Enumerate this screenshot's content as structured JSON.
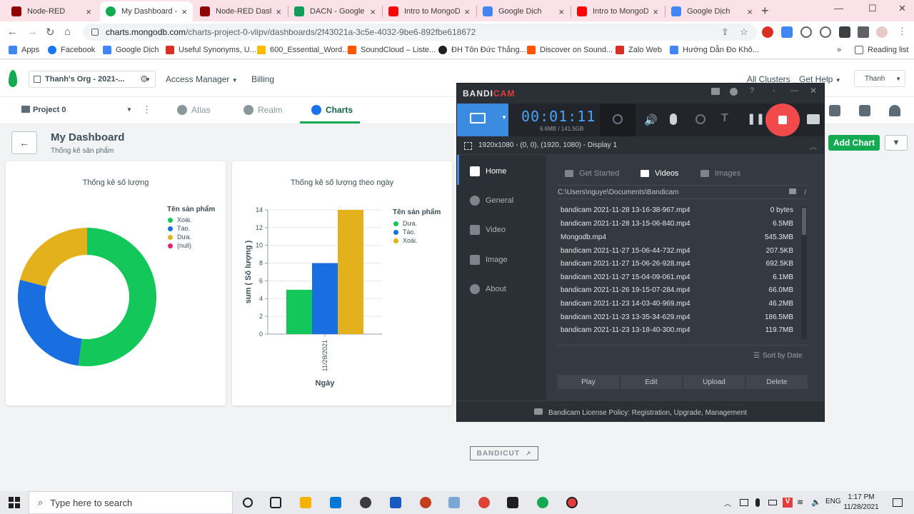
{
  "browser": {
    "tabs": [
      {
        "label": "Node-RED",
        "color": "#8f0000"
      },
      {
        "label": "My Dashboard - M",
        "color": "#13aa52"
      },
      {
        "label": "Node-RED Dashb",
        "color": "#8f0000"
      },
      {
        "label": "DACN - Google S",
        "color": "#0f9d58"
      },
      {
        "label": "Intro to MongoD",
        "color": "#ff0000"
      },
      {
        "label": "Google Dịch",
        "color": "#4285f4"
      },
      {
        "label": "Intro to MongoD",
        "color": "#ff0000"
      },
      {
        "label": "Google Dịch",
        "color": "#4285f4"
      }
    ],
    "url_host": "charts.mongodb.com",
    "url_path": "/charts-project-0-vlipv/dashboards/2f43021a-3c5e-4032-9be6-892fbe618672",
    "bookmarks": [
      "Apps",
      "Facebook",
      "Google Dịch",
      "Useful Synonyms, U...",
      "600_Essential_Word...",
      "SoundCloud – Liste...",
      "ĐH Tôn Đức Thắng...",
      "Discover on Sound...",
      "Zalo Web",
      "Hướng Dẫn Đo Khô..."
    ],
    "reading_list": "Reading list"
  },
  "app": {
    "org": "Thanh's Org - 2021-...",
    "access_manager": "Access Manager",
    "billing": "Billing",
    "all_clusters": "All Clusters",
    "get_help": "Get Help",
    "user": "Thanh",
    "project": "Project 0",
    "products": [
      "Atlas",
      "Realm",
      "Charts"
    ],
    "dashboard_title": "My Dashboard",
    "dashboard_subtitle": "Thống kê sản phẩm",
    "add_chart": "Add Chart"
  },
  "chart_data": [
    {
      "type": "pie",
      "title": "Thống kê số lượng",
      "legend_title": "Tên sản phẩm",
      "legend": [
        "Xoài.",
        "Táo.",
        "Dưa.",
        "(null)"
      ],
      "colors": [
        "#13c75a",
        "#1a6fe0",
        "#e2b11c",
        "#e0247a"
      ],
      "values": [
        52,
        27,
        21,
        0
      ],
      "donut": true,
      "legend_position": "top-right"
    },
    {
      "type": "bar",
      "title": "Thống kê số lượng theo ngày",
      "legend_title": "Tên sản phẩm",
      "categories": [
        "11/28/2021"
      ],
      "series": [
        {
          "name": "Dưa.",
          "values": [
            5
          ],
          "color": "#13c75a"
        },
        {
          "name": "Táo.",
          "values": [
            8
          ],
          "color": "#1a6fe0"
        },
        {
          "name": "Xoài.",
          "values": [
            14
          ],
          "color": "#e2b11c"
        }
      ],
      "xlabel": "Ngày",
      "ylabel": "sum ( Số lượng )",
      "ylim": [
        0,
        14
      ],
      "yticks": [
        "0",
        "2",
        "4",
        "6",
        "8",
        "10",
        "12",
        "14"
      ],
      "legend_position": "top-right"
    }
  ],
  "bandicam": {
    "brand_a": "BANDI",
    "brand_b": "CAM",
    "timer": "00:01:11",
    "size_info": "6.6MB / 141.5GB",
    "display": "1920x1080 - (0, 0), (1920, 1080) - Display 1",
    "nav": [
      "Home",
      "General",
      "Video",
      "Image",
      "About"
    ],
    "subtabs": [
      "Get Started",
      "Videos",
      "Images"
    ],
    "path": "C:\\Users\\nguye\\Documents\\Bandicam",
    "path_suffix": "/",
    "files": [
      {
        "name": "bandicam 2021-11-28 13-16-38-967.mp4",
        "size": "0 bytes"
      },
      {
        "name": "bandicam 2021-11-28 13-15-06-840.mp4",
        "size": "6.5MB"
      },
      {
        "name": "Mongodb.mp4",
        "size": "545.3MB"
      },
      {
        "name": "bandicam 2021-11-27 15-06-44-732.mp4",
        "size": "207.5KB"
      },
      {
        "name": "bandicam 2021-11-27 15-06-26-928.mp4",
        "size": "692.5KB"
      },
      {
        "name": "bandicam 2021-11-27 15-04-09-061.mp4",
        "size": "6.1MB"
      },
      {
        "name": "bandicam 2021-11-26 19-15-07-284.mp4",
        "size": "66.0MB"
      },
      {
        "name": "bandicam 2021-11-23 14-03-40-969.mp4",
        "size": "46.2MB"
      },
      {
        "name": "bandicam 2021-11-23 13-35-34-629.mp4",
        "size": "186.5MB"
      },
      {
        "name": "bandicam 2021-11-23 13-18-40-300.mp4",
        "size": "119.7MB"
      }
    ],
    "sort_by": "Sort by Date",
    "actions": [
      "Play",
      "Edit",
      "Upload",
      "Delete"
    ],
    "bandicut": "BANDICUT",
    "footer": "Bandicam License Policy: Registration, Upgrade, Management"
  },
  "taskbar": {
    "search_placeholder": "Type here to search",
    "lang": "ENG",
    "time": "1:17 PM",
    "date": "11/28/2021"
  }
}
